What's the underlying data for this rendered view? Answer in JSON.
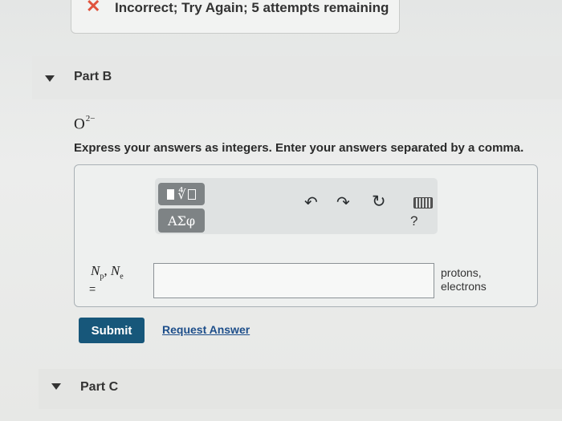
{
  "feedback": {
    "icon": "x-icon",
    "message": "Incorrect; Try Again; 5 attempts remaining",
    "icon_color": "#e0533d"
  },
  "part_b": {
    "title": "Part B",
    "ion_base": "O",
    "ion_charge": "2−",
    "instructions": "Express your answers as integers. Enter your answers separated by a comma.",
    "toolbar": {
      "template_icon": "fraction-root-template-icon",
      "greek_label": "ΑΣφ",
      "icons": [
        "undo-icon",
        "redo-icon",
        "reset-icon",
        "keyboard-icon",
        "help-icon"
      ],
      "help_label": "?"
    },
    "answer": {
      "label_vars": [
        "N",
        "N"
      ],
      "label_subs": [
        "p",
        "e"
      ],
      "equals": "=",
      "value": "",
      "units_line1": "protons,",
      "units_line2": "electrons"
    },
    "submit_label": "Submit",
    "request_label": "Request Answer"
  },
  "part_c": {
    "title": "Part C"
  },
  "colors": {
    "submit_bg": "#17577a",
    "link": "#1d4e8a",
    "tool_button": "#7e8385"
  }
}
